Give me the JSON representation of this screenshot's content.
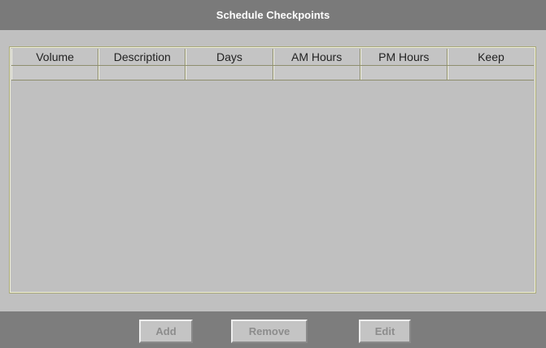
{
  "dialog": {
    "title": "Schedule Checkpoints"
  },
  "table": {
    "columns": [
      "Volume",
      "Description",
      "Days",
      "AM Hours",
      "PM Hours",
      "Keep"
    ],
    "rows": [
      [
        "",
        "",
        "",
        "",
        "",
        ""
      ]
    ]
  },
  "buttons": {
    "add": "Add",
    "remove": "Remove",
    "edit": "Edit"
  },
  "colors": {
    "titlebar": "#7a7a7a",
    "footer": "#7d7d7d",
    "background": "#c0c0c0",
    "disabled_text": "#8c8c8c"
  }
}
